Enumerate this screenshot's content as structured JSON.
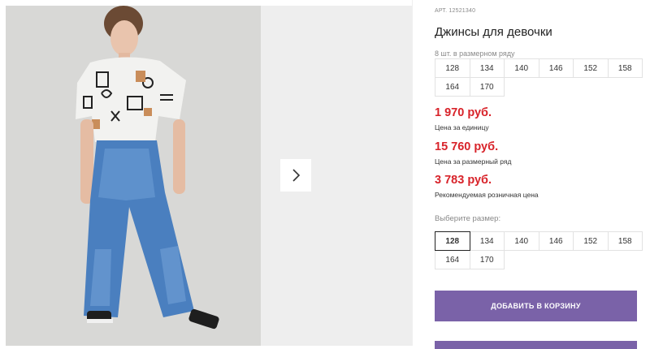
{
  "product": {
    "art": "АРТ. 12521340",
    "title": "Джинсы для девочки",
    "row_label": "8 шт. в размерном ряду",
    "row_sizes": [
      "128",
      "134",
      "140",
      "146",
      "152",
      "158",
      "164",
      "170"
    ],
    "prices": [
      {
        "value": "1 970 руб.",
        "note": "Цена за единицу"
      },
      {
        "value": "15 760 руб.",
        "note": "Цена за размерный ряд"
      },
      {
        "value": "3 783 руб.",
        "note": "Рекомендуемая розничная цена"
      }
    ],
    "choose_label": "Выберите размер:",
    "pick_sizes": [
      "128",
      "134",
      "140",
      "146",
      "152",
      "158",
      "164",
      "170"
    ],
    "selected_size": "128",
    "cart_button": "ДОБАВИТЬ В КОРЗИНУ"
  },
  "colors": {
    "price": "#d8232a",
    "accent": "#7a62a8"
  },
  "icons": {
    "next": "chevron-right-icon"
  }
}
